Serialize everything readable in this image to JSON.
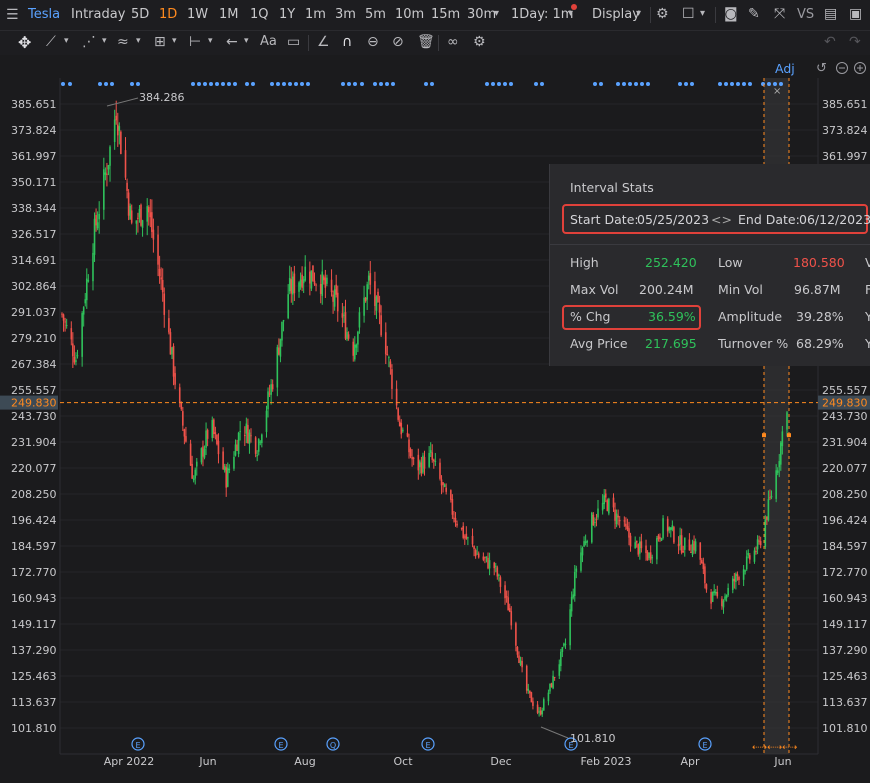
{
  "toolbar": {
    "symbol": "Tesla",
    "periods": [
      "Intraday",
      "5D",
      "1D",
      "1W",
      "1M",
      "1Q",
      "1Y",
      "1m",
      "3m",
      "5m",
      "10m",
      "15m",
      "30m"
    ],
    "active_period": "1D",
    "interval": "1Day: 1m",
    "display_label": "Display",
    "vs_label": "VS",
    "adj_label": "Adj"
  },
  "axis": {
    "y_ticks": [
      "385.651",
      "373.824",
      "361.997",
      "350.171",
      "338.344",
      "326.517",
      "314.691",
      "302.864",
      "291.037",
      "279.210",
      "267.384",
      "255.557",
      "243.730",
      "231.904",
      "220.077",
      "208.250",
      "196.424",
      "184.597",
      "172.770",
      "160.943",
      "149.117",
      "137.290",
      "125.463",
      "113.637",
      "101.810"
    ],
    "y_ticks_right": [
      "385.651",
      "373.824",
      "361.997",
      "",
      "",
      "",
      "",
      "",
      "",
      "",
      "",
      "255.557",
      "243.730",
      "231.904",
      "220.077",
      "208.250",
      "196.424",
      "184.597",
      "172.770",
      "160.943",
      "149.117",
      "137.290",
      "125.463",
      "113.637",
      "101.810"
    ],
    "x_labels": [
      "Apr 2022",
      "Jun",
      "Aug",
      "Oct",
      "Dec",
      "Feb 2023",
      "Apr",
      "Jun"
    ],
    "current_price": "249.830",
    "high_annotation": "384.286",
    "low_annotation": "101.810"
  },
  "interval_stats": {
    "title": "Interval Stats",
    "start_label": "Start Date:",
    "start_date": "05/25/2023",
    "end_label": "End Date:",
    "end_date": "06/12/2023",
    "high_label": "High",
    "high_value": "252.420",
    "low_label": "Low",
    "low_value": "180.580",
    "maxvol_label": "Max Vol",
    "maxvol_value": "200.24M",
    "minvol_label": "Min Vol",
    "minvol_value": "96.87M",
    "pct_label": "% Chg",
    "pct_value": "36.59%",
    "amp_label": "Amplitude",
    "amp_value": "39.28%",
    "avg_label": "Avg Price",
    "avg_value": "217.695",
    "turn_label": "Turnover %",
    "turn_value": "68.29%",
    "cut_col": [
      "V",
      "F",
      "Y",
      "Y"
    ]
  },
  "colors": {
    "up": "#2fc25b",
    "down": "#f0524a",
    "accent": "#ff8a1f",
    "link": "#5aa2ff"
  },
  "chart_data": {
    "type": "candlestick",
    "x_range": [
      "2022-03-01",
      "2023-06-12"
    ],
    "ylim": [
      101.81,
      385.651
    ],
    "highlight_range": [
      "2023-05-25",
      "2023-06-12"
    ],
    "current_price": 249.83,
    "close_path": [
      {
        "date": "2022-03-01",
        "close": 290
      },
      {
        "date": "2022-03-10",
        "close": 270
      },
      {
        "date": "2022-03-20",
        "close": 320
      },
      {
        "date": "2022-04-01",
        "close": 365
      },
      {
        "date": "2022-04-05",
        "close": 384
      },
      {
        "date": "2022-04-15",
        "close": 330
      },
      {
        "date": "2022-04-25",
        "close": 340
      },
      {
        "date": "2022-05-05",
        "close": 300
      },
      {
        "date": "2022-05-15",
        "close": 250
      },
      {
        "date": "2022-05-25",
        "close": 215
      },
      {
        "date": "2022-06-05",
        "close": 240
      },
      {
        "date": "2022-06-15",
        "close": 215
      },
      {
        "date": "2022-06-25",
        "close": 240
      },
      {
        "date": "2022-07-05",
        "close": 230
      },
      {
        "date": "2022-07-15",
        "close": 260
      },
      {
        "date": "2022-07-25",
        "close": 300
      },
      {
        "date": "2022-08-05",
        "close": 310
      },
      {
        "date": "2022-08-15",
        "close": 305
      },
      {
        "date": "2022-08-25",
        "close": 295
      },
      {
        "date": "2022-09-05",
        "close": 275
      },
      {
        "date": "2022-09-15",
        "close": 305
      },
      {
        "date": "2022-09-25",
        "close": 280
      },
      {
        "date": "2022-10-05",
        "close": 240
      },
      {
        "date": "2022-10-15",
        "close": 220
      },
      {
        "date": "2022-10-25",
        "close": 225
      },
      {
        "date": "2022-11-05",
        "close": 205
      },
      {
        "date": "2022-11-15",
        "close": 190
      },
      {
        "date": "2022-11-25",
        "close": 180
      },
      {
        "date": "2022-12-05",
        "close": 175
      },
      {
        "date": "2022-12-15",
        "close": 155
      },
      {
        "date": "2022-12-25",
        "close": 120
      },
      {
        "date": "2023-01-03",
        "close": 108
      },
      {
        "date": "2023-01-10",
        "close": 120
      },
      {
        "date": "2023-01-20",
        "close": 140
      },
      {
        "date": "2023-01-27",
        "close": 175
      },
      {
        "date": "2023-02-05",
        "close": 195
      },
      {
        "date": "2023-02-15",
        "close": 205
      },
      {
        "date": "2023-02-25",
        "close": 195
      },
      {
        "date": "2023-03-05",
        "close": 185
      },
      {
        "date": "2023-03-15",
        "close": 180
      },
      {
        "date": "2023-03-25",
        "close": 195
      },
      {
        "date": "2023-04-05",
        "close": 185
      },
      {
        "date": "2023-04-15",
        "close": 185
      },
      {
        "date": "2023-04-22",
        "close": 162
      },
      {
        "date": "2023-05-01",
        "close": 160
      },
      {
        "date": "2023-05-10",
        "close": 170
      },
      {
        "date": "2023-05-20",
        "close": 180
      },
      {
        "date": "2023-05-25",
        "close": 185
      },
      {
        "date": "2023-06-01",
        "close": 205
      },
      {
        "date": "2023-06-06",
        "close": 222
      },
      {
        "date": "2023-06-12",
        "close": 249.83
      }
    ]
  }
}
